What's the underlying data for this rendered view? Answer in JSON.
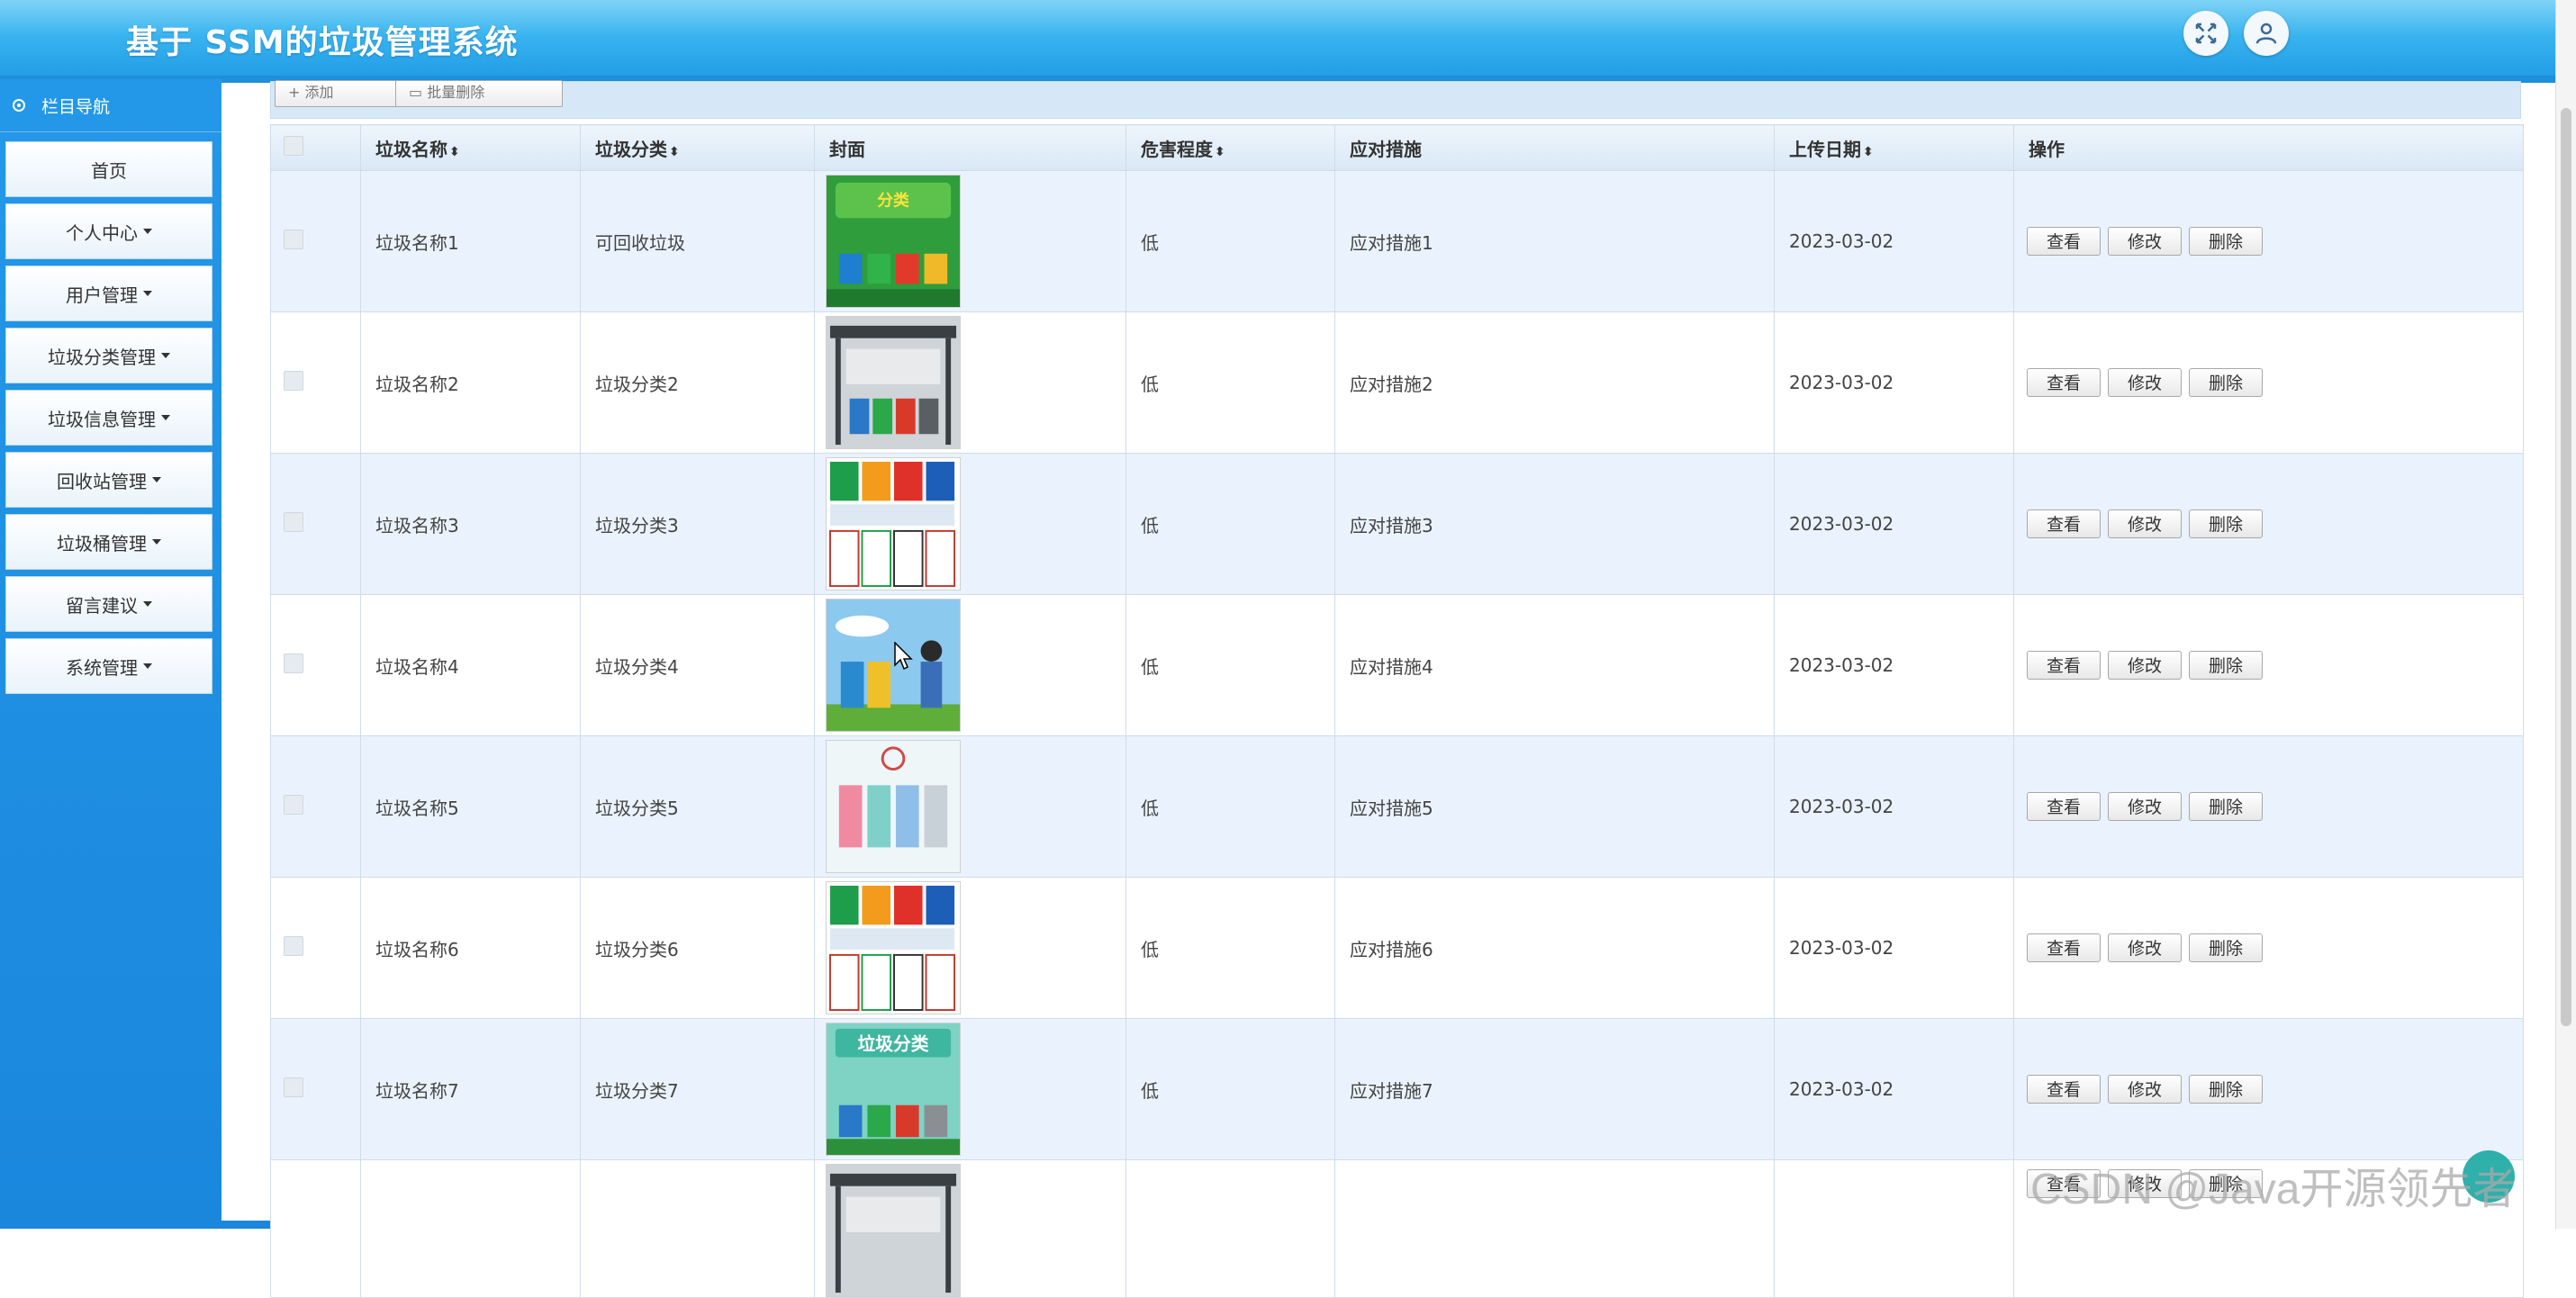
{
  "header": {
    "title": "基于 SSM的垃圾管理系统",
    "expand_icon": "fullscreen-icon",
    "user_icon": "user-icon",
    "gradient_top": "#7fd3f6",
    "gradient_bottom": "#1f9be6"
  },
  "sidebar": {
    "heading": "栏目导航",
    "items": [
      {
        "label": "首页",
        "has_caret": false
      },
      {
        "label": "个人中心",
        "has_caret": true
      },
      {
        "label": "用户管理",
        "has_caret": true
      },
      {
        "label": "垃圾分类管理",
        "has_caret": true
      },
      {
        "label": "垃圾信息管理",
        "has_caret": true
      },
      {
        "label": "回收站管理",
        "has_caret": true
      },
      {
        "label": "垃圾桶管理",
        "has_caret": true
      },
      {
        "label": "留言建议",
        "has_caret": true
      },
      {
        "label": "系统管理",
        "has_caret": true
      }
    ],
    "color": "#1a87dd"
  },
  "toolbar": {
    "add_label": "添加",
    "batch_delete_label": "批量删除"
  },
  "table": {
    "columns": [
      "垃圾名称",
      "垃圾分类",
      "封面",
      "危害程度",
      "应对措施",
      "上传日期",
      "操作"
    ],
    "sort_icon": "sort-icon",
    "rows": [
      {
        "name": "垃圾名称1",
        "category": "可回收垃圾",
        "hazard": "低",
        "measure": "应对措施1",
        "date": "2023-03-02",
        "cover": "sorting-poster"
      },
      {
        "name": "垃圾名称2",
        "category": "垃圾分类2",
        "hazard": "低",
        "measure": "应对措施2",
        "date": "2023-03-02",
        "cover": "bin-station"
      },
      {
        "name": "垃圾名称3",
        "category": "垃圾分类3",
        "hazard": "低",
        "measure": "应对措施3",
        "date": "2023-03-02",
        "cover": "sign-grid"
      },
      {
        "name": "垃圾名称4",
        "category": "垃圾分类4",
        "hazard": "低",
        "measure": "应对措施4",
        "date": "2023-03-02",
        "cover": "cartoon-bins"
      },
      {
        "name": "垃圾名称5",
        "category": "垃圾分类5",
        "hazard": "低",
        "measure": "应对措施5",
        "date": "2023-03-02",
        "cover": "infographic"
      },
      {
        "name": "垃圾名称6",
        "category": "垃圾分类6",
        "hazard": "低",
        "measure": "应对措施6",
        "date": "2023-03-02",
        "cover": "sign-grid"
      },
      {
        "name": "垃圾名称7",
        "category": "垃圾分类7",
        "hazard": "低",
        "measure": "应对措施7",
        "date": "2023-03-02",
        "cover": "garbage-sort-poster"
      }
    ],
    "actions": {
      "view": "查看",
      "edit": "修改",
      "delete": "删除"
    },
    "row_alt_color": "#eaf3fd"
  },
  "watermark": "CSDN @Java开源领先者"
}
